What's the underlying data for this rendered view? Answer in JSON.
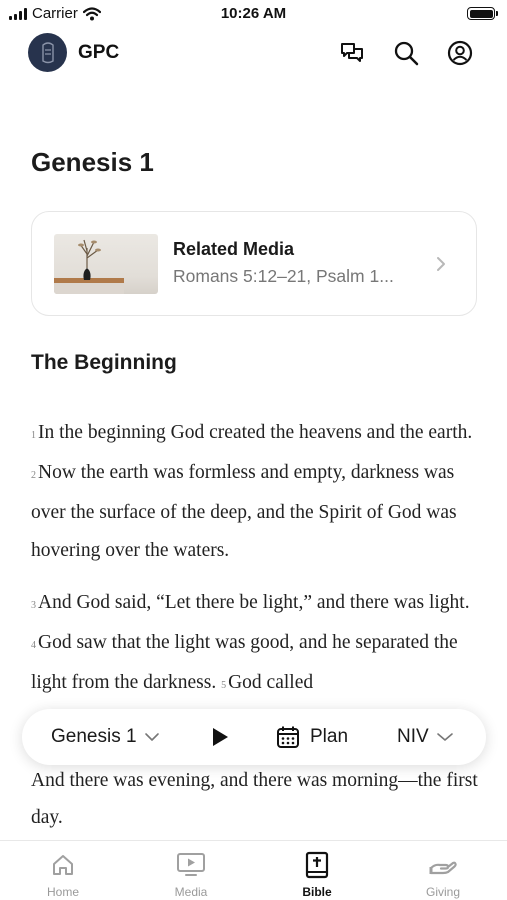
{
  "status_bar": {
    "carrier": "Carrier",
    "time": "10:26 AM"
  },
  "header": {
    "brand": "GPC",
    "icons": [
      "chat-icon",
      "search-icon",
      "profile-icon"
    ]
  },
  "page": {
    "title": "Genesis 1"
  },
  "related_media": {
    "title": "Related Media",
    "subtitle": "Romans 5:12–21, Psalm 1..."
  },
  "section": {
    "heading": "The Beginning"
  },
  "scripture": {
    "v1_num": "1",
    "v1_text": "In the beginning God created the heavens and the earth.",
    "v2_num": "2",
    "v2_text": "Now the earth was formless and empty, darkness was over the surface of the deep, and the Spirit of God was hovering over the waters.",
    "v3_num": "3",
    "v3_text": "And God said, “Let there be light,” and there was light.",
    "v4_num": "4",
    "v4_text": "God saw that the light was good, and he separated the light from the darkness.",
    "v5_num": "5",
    "v5_text": "God called",
    "tail_text": "And there was evening, and there was morning—the first day."
  },
  "player_bar": {
    "chapter": "Genesis 1",
    "plan_label": "Plan",
    "version": "NIV"
  },
  "tab_bar": {
    "tabs": [
      {
        "label": "Home",
        "icon": "home-icon",
        "active": false
      },
      {
        "label": "Media",
        "icon": "media-icon",
        "active": false
      },
      {
        "label": "Bible",
        "icon": "bible-icon",
        "active": true
      },
      {
        "label": "Giving",
        "icon": "giving-icon",
        "active": false
      }
    ]
  }
}
